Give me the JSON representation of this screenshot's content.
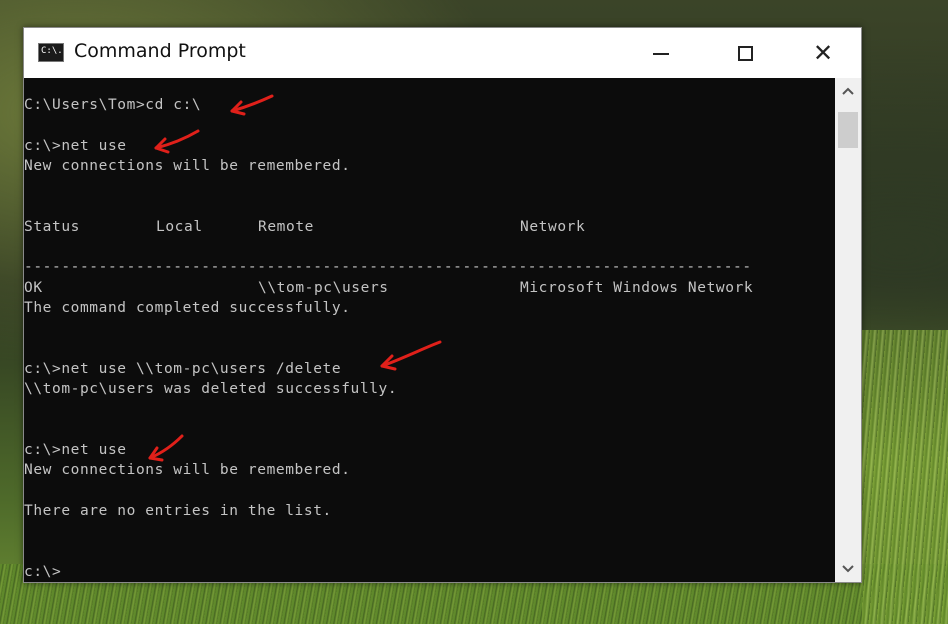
{
  "window": {
    "title": "Command Prompt",
    "icon_text": "C:\\.",
    "controls": {
      "minimize": "minimize-icon",
      "maximize": "maximize-icon",
      "close": "close-icon",
      "close_glyph": "✕"
    }
  },
  "console": {
    "lines": {
      "l1": "C:\\Users\\Tom>cd c:\\",
      "l2": "c:\\>net use",
      "l3": "New connections will be remembered.",
      "l5": "------------------------------------------------------------------------------",
      "l6_msg": "The command completed successfully.",
      "l7": "c:\\>net use \\\\tom-pc\\users /delete",
      "l8": "\\\\tom-pc\\users was deleted successfully.",
      "l9": "c:\\>net use",
      "l10": "New connections will be remembered.",
      "l11": "There are no entries in the list.",
      "l12": "c:\\>"
    },
    "table": {
      "headers": [
        "Status",
        "Local",
        "Remote",
        "Network"
      ],
      "row": {
        "status": "OK",
        "local": "",
        "remote": "\\\\tom-pc\\users",
        "network": "Microsoft Windows Network"
      }
    }
  },
  "scrollbar": {
    "up_glyph": "⌃",
    "down_glyph": "⌄"
  },
  "colors": {
    "console_bg": "#0c0c0c",
    "console_text": "#c4c4c4",
    "annotation_arrow": "#e0201a",
    "titlebar_bg": "#ffffff"
  }
}
